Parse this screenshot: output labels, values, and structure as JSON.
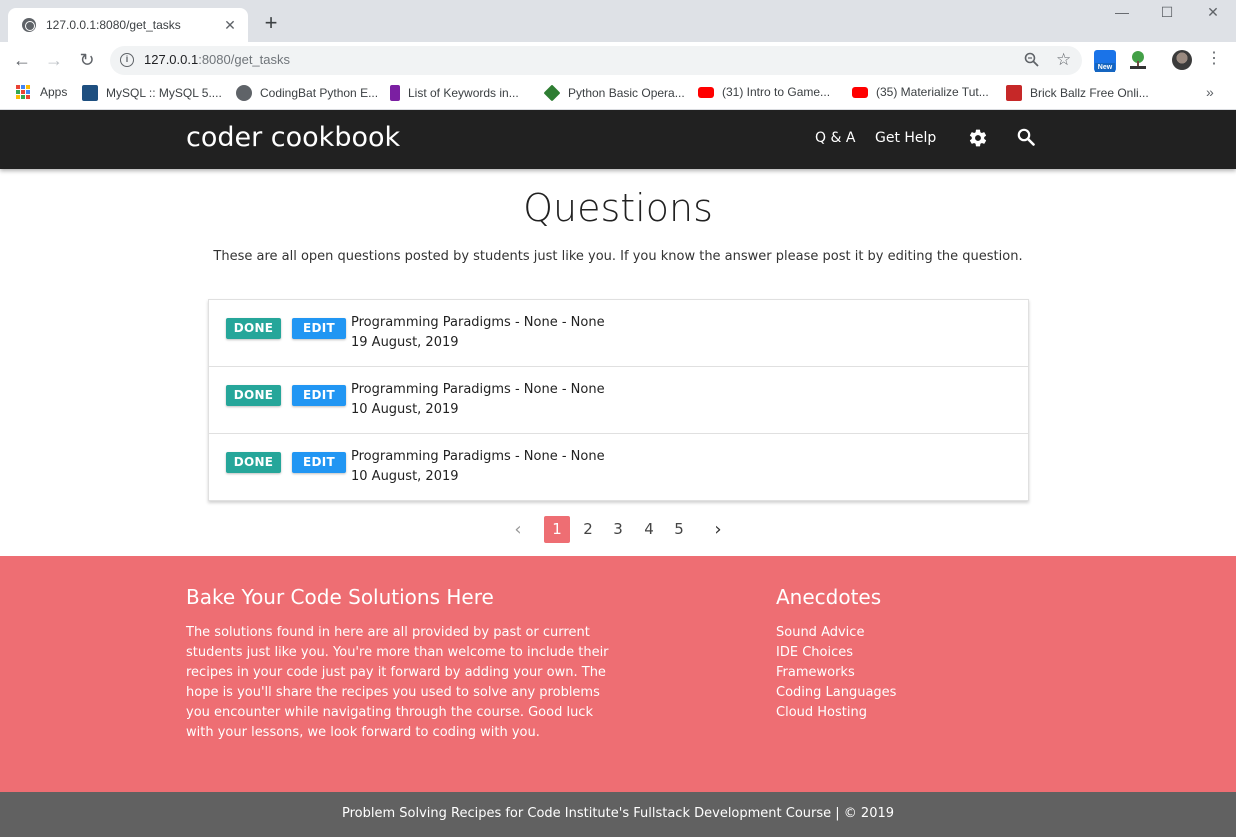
{
  "browser": {
    "tab_title": "127.0.0.1:8080/get_tasks",
    "tab_close": "✕",
    "new_tab": "+",
    "window_controls": {
      "minimize": "—",
      "maximize": "☐",
      "close": "✕"
    },
    "url_host": "127.0.0.1",
    "url_path": ":8080/get_tasks",
    "extension_badge": "New",
    "bookmarks": [
      {
        "label": "Apps",
        "icon": "apps-grid-icon"
      },
      {
        "label": "MySQL :: MySQL 5....",
        "icon": "mysql-icon",
        "color": "#1e4f80"
      },
      {
        "label": "CodingBat Python E...",
        "icon": "globe-icon",
        "color": "#5f6368"
      },
      {
        "label": "List of Keywords in...",
        "icon": "p-icon",
        "color": "#7b1fa2"
      },
      {
        "label": "Python Basic Opera...",
        "icon": "diamond-icon",
        "color": "#2e7d32"
      },
      {
        "label": "(31) Intro to Game...",
        "icon": "youtube-icon",
        "color": "#ff0000"
      },
      {
        "label": "(35) Materialize Tut...",
        "icon": "youtube-icon",
        "color": "#ff0000"
      },
      {
        "label": "Brick Ballz Free Onli...",
        "icon": "game-icon",
        "color": "#c62828"
      }
    ],
    "bookmarks_more": "»"
  },
  "nav": {
    "brand": "coder cookbook",
    "links": [
      "Q & A",
      "Get Help"
    ]
  },
  "main": {
    "heading": "Questions",
    "subtext": "These are all open questions posted by students just like you. If you know the answer please post it by editing the question.",
    "done_label": "DONE",
    "edit_label": "EDIT",
    "items": [
      {
        "title": "Programming Paradigms - None - None",
        "date": "19 August, 2019"
      },
      {
        "title": "Programming Paradigms - None - None",
        "date": "10 August, 2019"
      },
      {
        "title": "Programming Paradigms - None - None",
        "date": "10 August, 2019"
      }
    ]
  },
  "pagination": {
    "prev": "‹",
    "next": "›",
    "pages": [
      "1",
      "2",
      "3",
      "4",
      "5"
    ],
    "active": "1"
  },
  "footer": {
    "left_title": "Bake Your Code Solutions Here",
    "left_text": "The solutions found in here are all provided by past or current students just like you. You're more than welcome to include their recipes in your code just pay it forward by adding your own. The hope is you'll share the recipes you used to solve any problems you encounter while navigating through the course. Good luck with your lessons, we look forward to coding with you.",
    "right_title": "Anecdotes",
    "links": [
      "Sound Advice",
      "IDE Choices",
      "Frameworks",
      "Coding Languages",
      "Cloud Hosting"
    ],
    "copyright": "Problem Solving Recipes for Code Institute's Fullstack Development Course | © 2019"
  },
  "colors": {
    "navbar": "#212121",
    "done": "#26a69a",
    "edit": "#2196f3",
    "accent": "#ee6e73",
    "copyright_bar": "#616161"
  }
}
